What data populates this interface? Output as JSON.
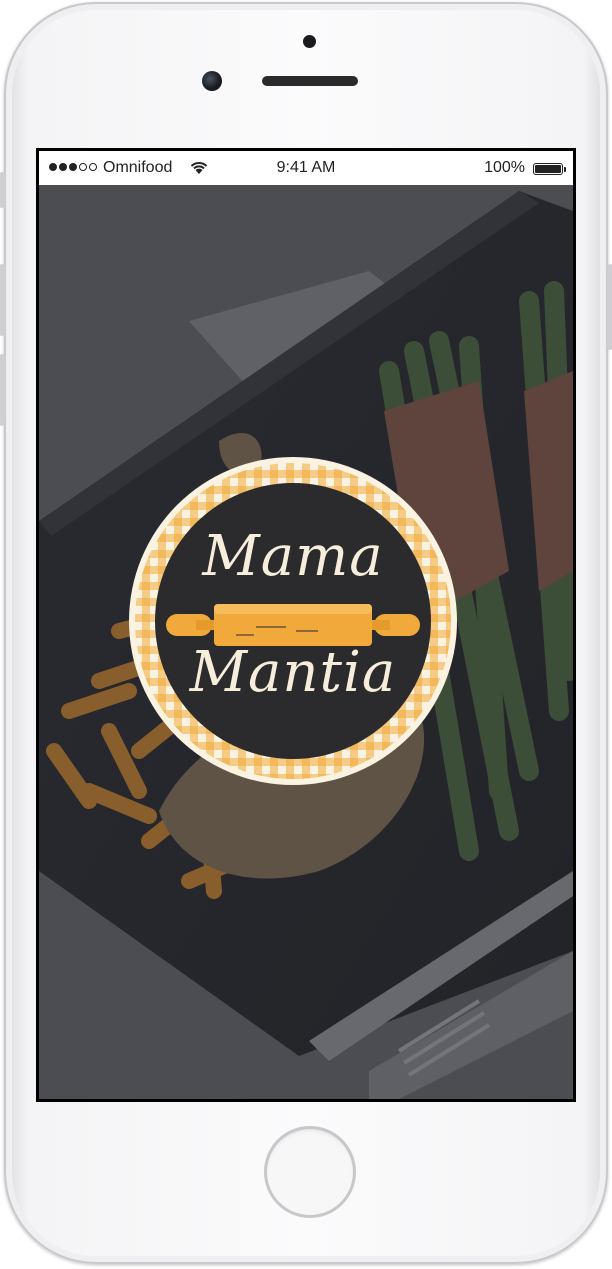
{
  "status_bar": {
    "carrier": "Omnifood",
    "time": "9:41 AM",
    "battery": "100%",
    "signal_dots_filled": 3,
    "signal_dots_total": 5
  },
  "logo": {
    "line1": "Mama",
    "line2": "Mantia",
    "colors": {
      "badge": "#2b2a2d",
      "checker": "#f0a93a",
      "text": "#f6eedb"
    }
  },
  "device": {
    "type": "iPhone",
    "color": "silver"
  },
  "icons": [
    "wifi-icon",
    "battery-icon",
    "rolling-pin-icon",
    "home-button"
  ]
}
